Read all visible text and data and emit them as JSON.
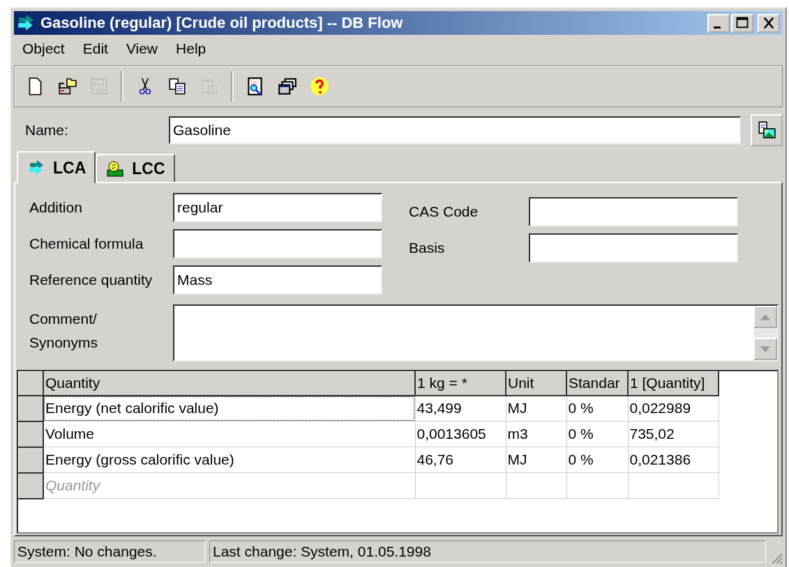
{
  "window": {
    "title": "Gasoline (regular) [Crude oil products] -- DB Flow"
  },
  "menu": [
    "Object",
    "Edit",
    "View",
    "Help"
  ],
  "toolbar": [
    [
      {
        "kind": "new",
        "disabled": false
      },
      {
        "kind": "open",
        "disabled": false
      },
      {
        "kind": "save",
        "disabled": true
      }
    ],
    [
      {
        "kind": "cut",
        "disabled": false
      },
      {
        "kind": "copy",
        "disabled": false
      },
      {
        "kind": "paste",
        "disabled": true
      }
    ],
    [
      {
        "kind": "preview",
        "disabled": false
      },
      {
        "kind": "windows",
        "disabled": false
      },
      {
        "kind": "help",
        "disabled": false
      }
    ]
  ],
  "name": {
    "label": "Name:",
    "value": "Gasoline"
  },
  "tabs": [
    {
      "label": "LCA",
      "kind": "lca",
      "selected": true
    },
    {
      "label": "LCC",
      "kind": "lcc",
      "selected": false
    }
  ],
  "fields_left": [
    {
      "label": "Addition",
      "value": "regular"
    },
    {
      "label": "Chemical formula"
    },
    {
      "label": "Reference quantity",
      "value": "Mass"
    }
  ],
  "fields_right": [
    {
      "label": "CAS Code"
    },
    {
      "label": "Basis"
    }
  ],
  "comment": {
    "label": "Comment/ Synonyms"
  },
  "table": {
    "columns": [
      "Quantity",
      "1 kg = *",
      "Unit",
      "Standar",
      "1 [Quantity]"
    ],
    "rows": [
      {
        "cells": [
          "Energy (net calorific value)",
          "43,499",
          "MJ",
          "0 %",
          "0,022989"
        ],
        "focused": true
      },
      {
        "cells": [
          "Volume",
          "0,0013605",
          "m3",
          "0 %",
          "735,02"
        ],
        "focused": false
      },
      {
        "cells": [
          "Energy (gross calorific value)",
          "46,76",
          "MJ",
          "0 %",
          "0,021386"
        ],
        "focused": false
      }
    ],
    "new_row": {
      "placeholder": "Quantity"
    }
  },
  "status_bar": [
    "System: No changes.",
    "Last change: System, 01.05.1998"
  ]
}
